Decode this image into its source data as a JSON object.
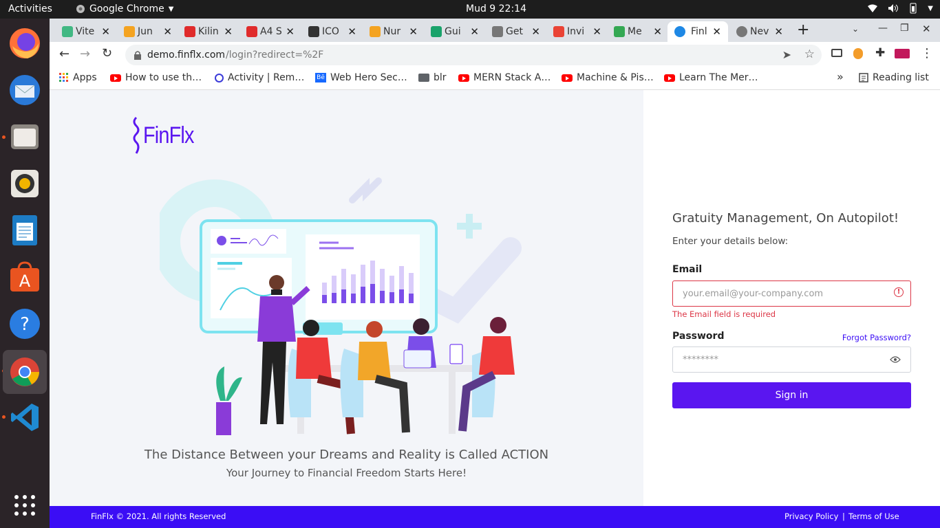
{
  "system": {
    "activities": "Activities",
    "app_name": "Google Chrome",
    "clock": "Mud 9  22:14"
  },
  "tabs": [
    {
      "label": "Vite",
      "color": "#41b883"
    },
    {
      "label": "Jun",
      "color": "#f4a321"
    },
    {
      "label": "Kilin",
      "color": "#e02b2b"
    },
    {
      "label": "A4 S",
      "color": "#e02b2b"
    },
    {
      "label": "ICO",
      "color": "#333333"
    },
    {
      "label": "Nur",
      "color": "#f4a321"
    },
    {
      "label": "Gui",
      "color": "#1aa36b"
    },
    {
      "label": "Get",
      "color": "#777777"
    },
    {
      "label": "Invi",
      "color": "#ea4335"
    },
    {
      "label": "Me",
      "color": "#34a853"
    },
    {
      "label": "Finl",
      "color": "#1e88e5"
    },
    {
      "label": "Nev",
      "color": "#777777"
    }
  ],
  "omnibox": {
    "url_host": "demo.finflx.com",
    "url_path": "/login?redirect=%2F"
  },
  "bookmarks": {
    "apps": "Apps",
    "items": [
      {
        "label": "How to use th…",
        "icon": "youtube"
      },
      {
        "label": "Activity | Rem…",
        "icon": "circle"
      },
      {
        "label": "Web Hero Sec…",
        "icon": "behance"
      },
      {
        "label": "blr",
        "icon": "folder"
      },
      {
        "label": "MERN Stack A…",
        "icon": "youtube"
      },
      {
        "label": "Machine & Pis…",
        "icon": "youtube"
      },
      {
        "label": "Learn The Mer…",
        "icon": "youtube"
      }
    ],
    "more": "»",
    "reading_list": "Reading list"
  },
  "brand": {
    "logo_text": "FinFlx",
    "accent": "#5a16f0"
  },
  "hero": {
    "quote": "The Distance Between your Dreams and Reality is Called ACTION",
    "subline": "Your Journey to Financial Freedom Starts Here!"
  },
  "login": {
    "heading": "Gratuity Management, On Autopilot!",
    "subheading": "Enter your details below:",
    "email_label": "Email",
    "email_placeholder": "your.email@your-company.com",
    "email_error": "The Email field is required",
    "password_label": "Password",
    "forgot": "Forgot Password?",
    "password_placeholder": "********",
    "signin": "Sign in"
  },
  "footer": {
    "copyright": "FinFlx © 2021. All rights Reserved",
    "privacy": "Privacy Policy",
    "sep": "|",
    "terms": "Terms of Use"
  }
}
